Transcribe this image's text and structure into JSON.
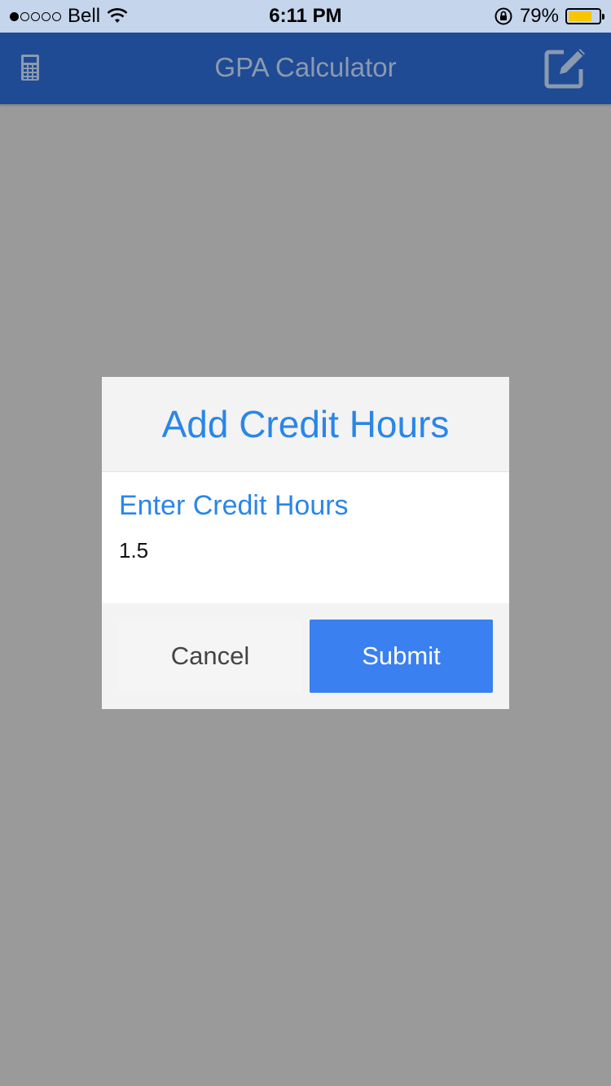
{
  "status_bar": {
    "carrier": "Bell",
    "time": "6:11 PM",
    "battery_percent": "79%",
    "battery_level": 0.79,
    "signal_bars_filled": 1,
    "signal_bars_total": 5,
    "icons": [
      "signal-dots-icon",
      "wifi-icon",
      "orientation-lock-icon",
      "battery-icon"
    ]
  },
  "nav_bar": {
    "title": "GPA Calculator",
    "left_icon": "calculator-icon",
    "right_icon": "edit-icon",
    "background_color": "#1f4a94"
  },
  "dialog": {
    "title": "Add Credit Hours",
    "field_label": "Enter Credit Hours",
    "field_value": "1.5",
    "cancel_label": "Cancel",
    "submit_label": "Submit",
    "accent_color": "#2a86e8",
    "submit_color": "#3a80f0"
  }
}
